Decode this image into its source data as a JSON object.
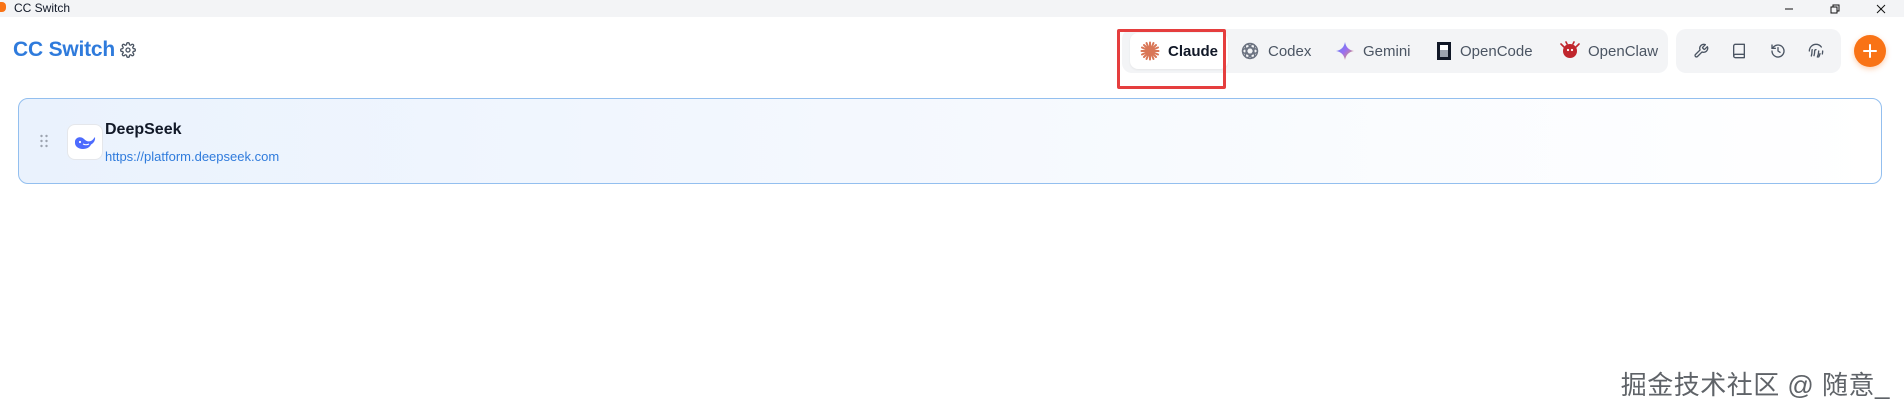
{
  "window": {
    "title": "CC Switch"
  },
  "header": {
    "app_name": "CC Switch",
    "settings_icon": "gear-icon"
  },
  "app_tabs": [
    {
      "label": "Claude",
      "icon": "claude-starburst-icon",
      "active": true
    },
    {
      "label": "Codex",
      "icon": "openai-knot-icon",
      "active": false
    },
    {
      "label": "Gemini",
      "icon": "gemini-sparkle-icon",
      "active": false
    },
    {
      "label": "OpenCode",
      "icon": "opencode-icon",
      "active": false
    },
    {
      "label": "OpenClaw",
      "icon": "openclaw-icon",
      "active": false
    }
  ],
  "toolbar": {
    "icons": [
      "wrench-icon",
      "book-icon",
      "history-icon",
      "fingerprint-icon"
    ],
    "add_icon": "plus-icon"
  },
  "providers": [
    {
      "name": "DeepSeek",
      "url": "https://platform.deepseek.com",
      "icon": "deepseek-whale-icon"
    }
  ],
  "watermark": "掘金技术社区 @ 随意_",
  "colors": {
    "brand_blue": "#2f7bdc",
    "accent_orange": "#f97316",
    "highlight_red": "#e53e3e",
    "card_border": "#93bfef"
  }
}
